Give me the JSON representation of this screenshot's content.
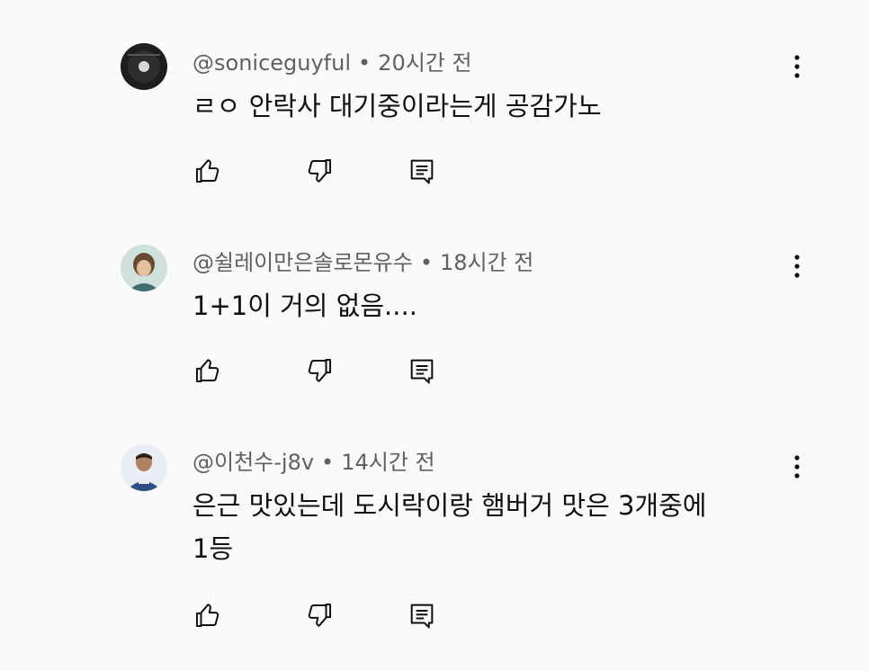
{
  "comments": [
    {
      "author": "@soniceguyful",
      "time": "20시간 전",
      "separator": "•",
      "lines": [
        "ㄹㅇ 안락사 대기중이라는게 공감가노"
      ],
      "avatar_bg": "#1a1a1a"
    },
    {
      "author": "@쉴레이만은솔로몬유수",
      "time": "18시간 전",
      "separator": "•",
      "lines": [
        "1+1이 거의 없음...."
      ],
      "avatar_bg": "#8fb3b0"
    },
    {
      "author": "@이천수-j8v",
      "time": "14시간 전",
      "separator": "•",
      "lines": [
        "은근 맛있는데 도시락이랑 햄버거 맛은 3개중에",
        "1등"
      ],
      "avatar_bg": "#2d4f86"
    }
  ],
  "icons": {
    "like": "thumbs-up-icon",
    "dislike": "thumbs-down-icon",
    "reply": "reply-icon",
    "more": "more-vertical-icon"
  },
  "colors": {
    "background": "#fafafa",
    "text": "#0f0f0f",
    "meta": "#606060"
  }
}
